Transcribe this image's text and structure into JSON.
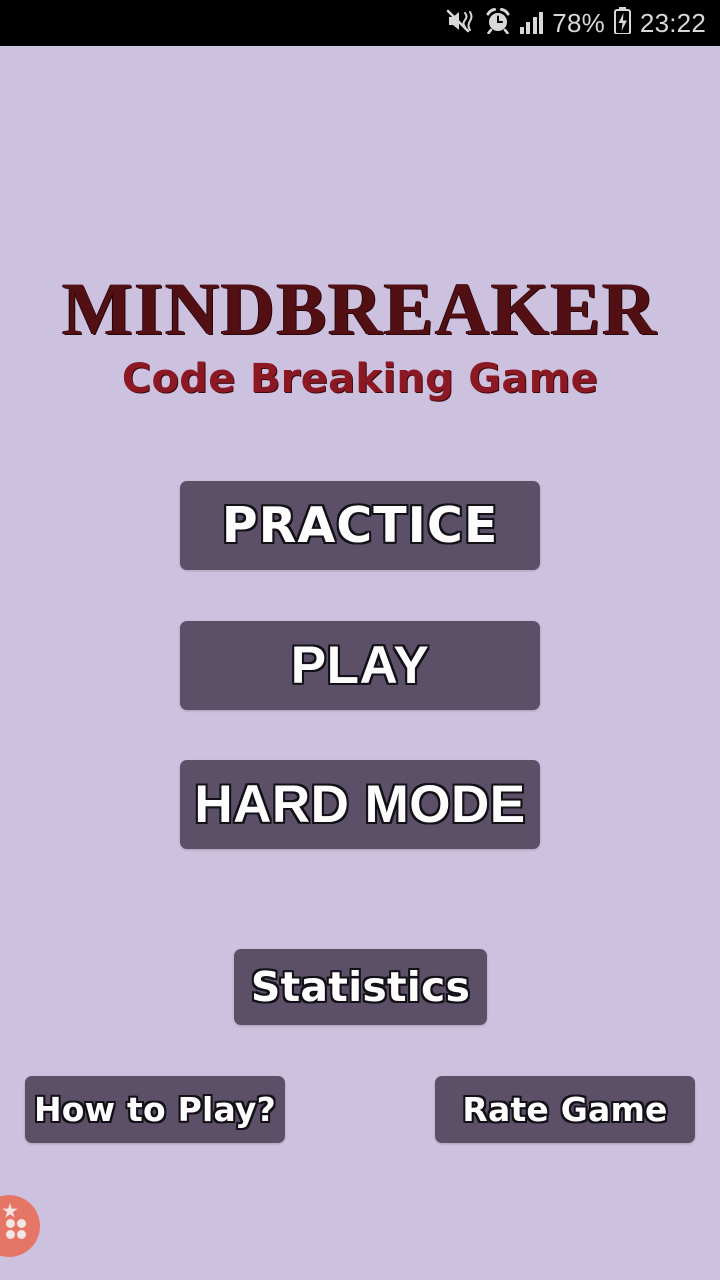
{
  "status_bar": {
    "icons": [
      "mute-vibrate-icon",
      "alarm-clock-icon",
      "signal-bars-icon",
      "battery-charging-icon"
    ],
    "battery_percent": "78%",
    "time": "23:22",
    "background_color": "#000000",
    "text_color": "#d8d8d8"
  },
  "title_block": {
    "title": "MINDBREAKER",
    "subtitle": "Code Breaking Game",
    "title_color": "#520f14",
    "subtitle_color": "#8b1822"
  },
  "menu": {
    "primary_buttons": [
      {
        "label": "PRACTICE"
      },
      {
        "label": "PLAY"
      },
      {
        "label": "HARD MODE"
      }
    ],
    "stats_label": "Statistics",
    "bottom_buttons": [
      {
        "label": "How to Play?"
      },
      {
        "label": "Rate Game"
      }
    ],
    "button_color": "#5c5068",
    "button_text_color": "#fdfdfd"
  },
  "overlay": {
    "fab_icon": "dots-star-bubble-icon",
    "fab_color": "#e8705c"
  },
  "screen": {
    "background_color": "#ccc1de"
  }
}
